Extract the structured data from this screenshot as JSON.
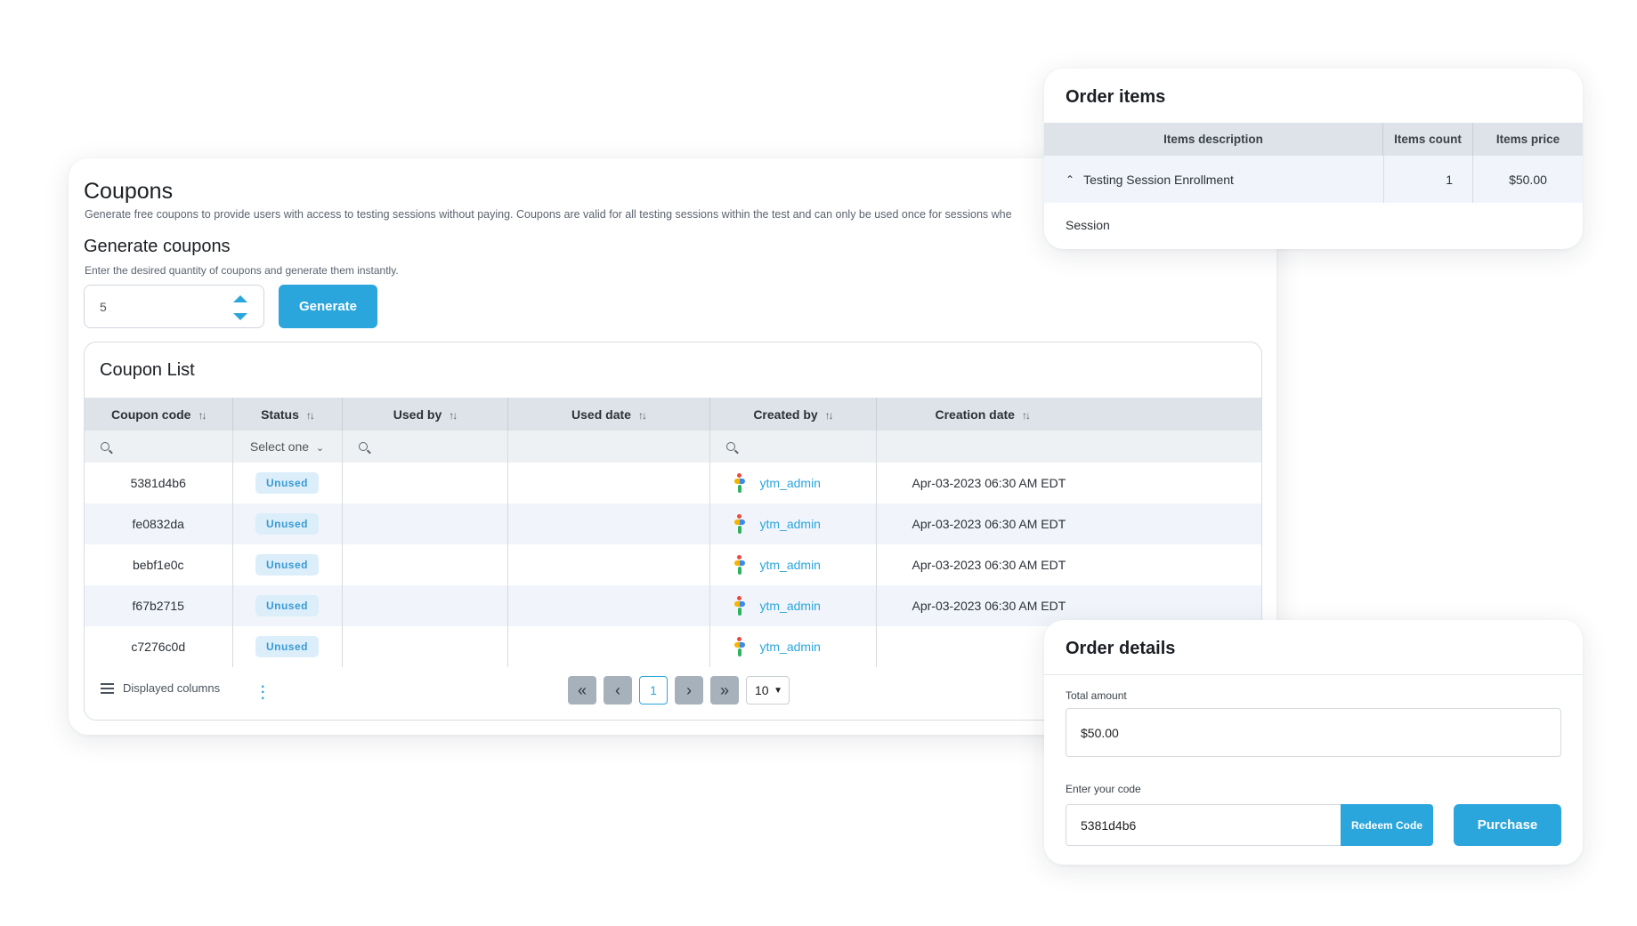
{
  "coupons": {
    "title": "Coupons",
    "description": "Generate free coupons to provide users with access to testing sessions without paying. Coupons are valid for all testing sessions within the test and can only be used once for sessions whe"
  },
  "generate": {
    "title": "Generate coupons",
    "description": "Enter the desired quantity of coupons and generate them instantly.",
    "quantity": "5",
    "button_label": "Generate"
  },
  "coupon_list": {
    "title": "Coupon List",
    "columns": [
      "Coupon code",
      "Status",
      "Used by",
      "Used date",
      "Created by",
      "Creation date"
    ],
    "status_filter_placeholder": "Select one",
    "rows": [
      {
        "code": "5381d4b6",
        "status": "Unused",
        "used_by": "",
        "used_date": "",
        "created_by": "ytm_admin",
        "creation_date": "Apr-03-2023 06:30 AM EDT"
      },
      {
        "code": "fe0832da",
        "status": "Unused",
        "used_by": "",
        "used_date": "",
        "created_by": "ytm_admin",
        "creation_date": "Apr-03-2023 06:30 AM EDT"
      },
      {
        "code": "bebf1e0c",
        "status": "Unused",
        "used_by": "",
        "used_date": "",
        "created_by": "ytm_admin",
        "creation_date": "Apr-03-2023 06:30 AM EDT"
      },
      {
        "code": "f67b2715",
        "status": "Unused",
        "used_by": "",
        "used_date": "",
        "created_by": "ytm_admin",
        "creation_date": "Apr-03-2023 06:30 AM EDT"
      },
      {
        "code": "c7276c0d",
        "status": "Unused",
        "used_by": "",
        "used_date": "",
        "created_by": "ytm_admin",
        "creation_date": ""
      }
    ],
    "footer": {
      "displayed_columns_label": "Displayed columns",
      "current_page": "1",
      "page_size": "10"
    }
  },
  "order_items": {
    "title": "Order items",
    "columns": [
      "Items description",
      "Items count",
      "Items price"
    ],
    "item": {
      "description": "Testing Session Enrollment",
      "count": "1",
      "price": "$50.00"
    },
    "sub_item": "Session"
  },
  "order_details": {
    "title": "Order details",
    "total_label": "Total amount",
    "total_value": "$50.00",
    "code_label": "Enter your code",
    "code_value": "5381d4b6",
    "redeem_label": "Redeem Code",
    "purchase_label": "Purchase"
  },
  "colors": {
    "accent": "#2ba6dd",
    "header_bg": "#dde3e8",
    "badge_bg": "#dbeefa",
    "alt_row_bg": "#f1f5fb"
  }
}
